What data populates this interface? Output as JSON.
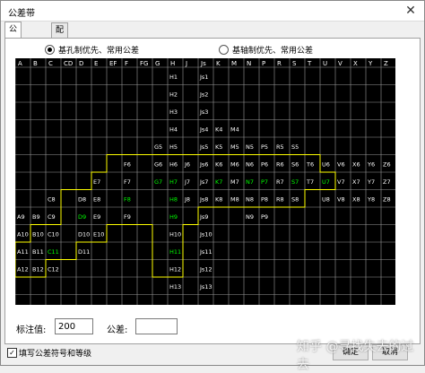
{
  "window": {
    "title": "公差带"
  },
  "tabs": [
    {
      "label": "公差查询",
      "active": true
    },
    {
      "label": "配合查询",
      "active": false
    }
  ],
  "options": {
    "hole_basis": {
      "label": "基孔制优先、常用公差",
      "checked": true
    },
    "shaft_basis": {
      "label": "基轴制优先、常用公差",
      "checked": false
    }
  },
  "columns": [
    "A",
    "B",
    "C",
    "CD",
    "D",
    "E",
    "EF",
    "F",
    "FG",
    "G",
    "H",
    "J",
    "Js",
    "K",
    "M",
    "N",
    "P",
    "R",
    "S",
    "T",
    "U",
    "V",
    "X",
    "Y",
    "Z"
  ],
  "cells": [
    {
      "t": "H1",
      "c": 10,
      "r": 1,
      "col": "w"
    },
    {
      "t": "Js1",
      "c": 12,
      "r": 1,
      "col": "w"
    },
    {
      "t": "H2",
      "c": 10,
      "r": 2,
      "col": "w"
    },
    {
      "t": "Js2",
      "c": 12,
      "r": 2,
      "col": "w"
    },
    {
      "t": "H3",
      "c": 10,
      "r": 3,
      "col": "w"
    },
    {
      "t": "Js3",
      "c": 12,
      "r": 3,
      "col": "w"
    },
    {
      "t": "H4",
      "c": 10,
      "r": 4,
      "col": "w"
    },
    {
      "t": "Js4",
      "c": 12,
      "r": 4,
      "col": "w"
    },
    {
      "t": "K4",
      "c": 13,
      "r": 4,
      "col": "w"
    },
    {
      "t": "M4",
      "c": 14,
      "r": 4,
      "col": "w"
    },
    {
      "t": "G5",
      "c": 9,
      "r": 5,
      "col": "w"
    },
    {
      "t": "H5",
      "c": 10,
      "r": 5,
      "col": "w"
    },
    {
      "t": "Js5",
      "c": 12,
      "r": 5,
      "col": "w"
    },
    {
      "t": "K5",
      "c": 13,
      "r": 5,
      "col": "w"
    },
    {
      "t": "M5",
      "c": 14,
      "r": 5,
      "col": "w"
    },
    {
      "t": "N5",
      "c": 15,
      "r": 5,
      "col": "w"
    },
    {
      "t": "P5",
      "c": 16,
      "r": 5,
      "col": "w"
    },
    {
      "t": "R5",
      "c": 17,
      "r": 5,
      "col": "w"
    },
    {
      "t": "S5",
      "c": 18,
      "r": 5,
      "col": "w"
    },
    {
      "t": "F6",
      "c": 7,
      "r": 6,
      "col": "w"
    },
    {
      "t": "G6",
      "c": 9,
      "r": 6,
      "col": "w"
    },
    {
      "t": "H6",
      "c": 10,
      "r": 6,
      "col": "w"
    },
    {
      "t": "J6",
      "c": 11,
      "r": 6,
      "col": "w"
    },
    {
      "t": "Js6",
      "c": 12,
      "r": 6,
      "col": "w"
    },
    {
      "t": "K6",
      "c": 13,
      "r": 6,
      "col": "w"
    },
    {
      "t": "M6",
      "c": 14,
      "r": 6,
      "col": "w"
    },
    {
      "t": "N6",
      "c": 15,
      "r": 6,
      "col": "w"
    },
    {
      "t": "P6",
      "c": 16,
      "r": 6,
      "col": "w"
    },
    {
      "t": "R6",
      "c": 17,
      "r": 6,
      "col": "w"
    },
    {
      "t": "S6",
      "c": 18,
      "r": 6,
      "col": "w"
    },
    {
      "t": "T6",
      "c": 19,
      "r": 6,
      "col": "w"
    },
    {
      "t": "U6",
      "c": 20,
      "r": 6,
      "col": "w"
    },
    {
      "t": "V6",
      "c": 21,
      "r": 6,
      "col": "w"
    },
    {
      "t": "X6",
      "c": 22,
      "r": 6,
      "col": "w"
    },
    {
      "t": "Y6",
      "c": 23,
      "r": 6,
      "col": "w"
    },
    {
      "t": "Z6",
      "c": 24,
      "r": 6,
      "col": "w"
    },
    {
      "t": "E7",
      "c": 5,
      "r": 7,
      "col": "w"
    },
    {
      "t": "F7",
      "c": 7,
      "r": 7,
      "col": "w"
    },
    {
      "t": "G7",
      "c": 9,
      "r": 7,
      "col": "g"
    },
    {
      "t": "H7",
      "c": 10,
      "r": 7,
      "col": "g"
    },
    {
      "t": "J7",
      "c": 11,
      "r": 7,
      "col": "w"
    },
    {
      "t": "Js7",
      "c": 12,
      "r": 7,
      "col": "w"
    },
    {
      "t": "K7",
      "c": 13,
      "r": 7,
      "col": "g"
    },
    {
      "t": "M7",
      "c": 14,
      "r": 7,
      "col": "w"
    },
    {
      "t": "N7",
      "c": 15,
      "r": 7,
      "col": "g"
    },
    {
      "t": "P7",
      "c": 16,
      "r": 7,
      "col": "g"
    },
    {
      "t": "R7",
      "c": 17,
      "r": 7,
      "col": "w"
    },
    {
      "t": "S7",
      "c": 18,
      "r": 7,
      "col": "g"
    },
    {
      "t": "T7",
      "c": 19,
      "r": 7,
      "col": "w"
    },
    {
      "t": "U7",
      "c": 20,
      "r": 7,
      "col": "g"
    },
    {
      "t": "V7",
      "c": 21,
      "r": 7,
      "col": "w"
    },
    {
      "t": "X7",
      "c": 22,
      "r": 7,
      "col": "w"
    },
    {
      "t": "Y7",
      "c": 23,
      "r": 7,
      "col": "w"
    },
    {
      "t": "Z7",
      "c": 24,
      "r": 7,
      "col": "w"
    },
    {
      "t": "C8",
      "c": 2,
      "r": 8,
      "col": "w"
    },
    {
      "t": "D8",
      "c": 4,
      "r": 8,
      "col": "w"
    },
    {
      "t": "E8",
      "c": 5,
      "r": 8,
      "col": "w"
    },
    {
      "t": "F8",
      "c": 7,
      "r": 8,
      "col": "g"
    },
    {
      "t": "H8",
      "c": 10,
      "r": 8,
      "col": "g"
    },
    {
      "t": "J8",
      "c": 11,
      "r": 8,
      "col": "w"
    },
    {
      "t": "Js8",
      "c": 12,
      "r": 8,
      "col": "w"
    },
    {
      "t": "K8",
      "c": 13,
      "r": 8,
      "col": "w"
    },
    {
      "t": "M8",
      "c": 14,
      "r": 8,
      "col": "w"
    },
    {
      "t": "N8",
      "c": 15,
      "r": 8,
      "col": "w"
    },
    {
      "t": "P8",
      "c": 16,
      "r": 8,
      "col": "w"
    },
    {
      "t": "R8",
      "c": 17,
      "r": 8,
      "col": "w"
    },
    {
      "t": "S8",
      "c": 18,
      "r": 8,
      "col": "w"
    },
    {
      "t": "U8",
      "c": 20,
      "r": 8,
      "col": "w"
    },
    {
      "t": "V8",
      "c": 21,
      "r": 8,
      "col": "w"
    },
    {
      "t": "X8",
      "c": 22,
      "r": 8,
      "col": "w"
    },
    {
      "t": "Y8",
      "c": 23,
      "r": 8,
      "col": "w"
    },
    {
      "t": "Z8",
      "c": 24,
      "r": 8,
      "col": "w"
    },
    {
      "t": "A9",
      "c": 0,
      "r": 9,
      "col": "w"
    },
    {
      "t": "B9",
      "c": 1,
      "r": 9,
      "col": "w"
    },
    {
      "t": "C9",
      "c": 2,
      "r": 9,
      "col": "w"
    },
    {
      "t": "D9",
      "c": 4,
      "r": 9,
      "col": "g"
    },
    {
      "t": "E9",
      "c": 5,
      "r": 9,
      "col": "w"
    },
    {
      "t": "F9",
      "c": 7,
      "r": 9,
      "col": "w"
    },
    {
      "t": "H9",
      "c": 10,
      "r": 9,
      "col": "g"
    },
    {
      "t": "Js9",
      "c": 12,
      "r": 9,
      "col": "w"
    },
    {
      "t": "N9",
      "c": 15,
      "r": 9,
      "col": "w"
    },
    {
      "t": "P9",
      "c": 16,
      "r": 9,
      "col": "w"
    },
    {
      "t": "A10",
      "c": 0,
      "r": 10,
      "col": "w"
    },
    {
      "t": "B10",
      "c": 1,
      "r": 10,
      "col": "w"
    },
    {
      "t": "C10",
      "c": 2,
      "r": 10,
      "col": "w"
    },
    {
      "t": "D10",
      "c": 4,
      "r": 10,
      "col": "w"
    },
    {
      "t": "E10",
      "c": 5,
      "r": 10,
      "col": "w"
    },
    {
      "t": "H10",
      "c": 10,
      "r": 10,
      "col": "w"
    },
    {
      "t": "Js10",
      "c": 12,
      "r": 10,
      "col": "w"
    },
    {
      "t": "A11",
      "c": 0,
      "r": 11,
      "col": "w"
    },
    {
      "t": "B11",
      "c": 1,
      "r": 11,
      "col": "w"
    },
    {
      "t": "C11",
      "c": 2,
      "r": 11,
      "col": "g"
    },
    {
      "t": "D11",
      "c": 4,
      "r": 11,
      "col": "w"
    },
    {
      "t": "H11",
      "c": 10,
      "r": 11,
      "col": "g"
    },
    {
      "t": "Js11",
      "c": 12,
      "r": 11,
      "col": "w"
    },
    {
      "t": "A12",
      "c": 0,
      "r": 12,
      "col": "w"
    },
    {
      "t": "B12",
      "c": 1,
      "r": 12,
      "col": "w"
    },
    {
      "t": "C12",
      "c": 2,
      "r": 12,
      "col": "w"
    },
    {
      "t": "H12",
      "c": 10,
      "r": 12,
      "col": "w"
    },
    {
      "t": "Js12",
      "c": 12,
      "r": 12,
      "col": "w"
    },
    {
      "t": "H13",
      "c": 10,
      "r": 13,
      "col": "w"
    },
    {
      "t": "Js13",
      "c": 12,
      "r": 13,
      "col": "w"
    }
  ],
  "fields": {
    "nominal_label": "标注值:",
    "nominal_value": "200",
    "tolerance_label": "公差:",
    "tolerance_value": ""
  },
  "footer": {
    "checkbox_label": "填写公差符号和等级",
    "checkbox_checked": true,
    "ok_label": "确定",
    "cancel_label": "取消"
  },
  "watermark": "知乎 @寻找失去的过去",
  "colors": {
    "grid_bg": "#000000",
    "grid_line": "#9a9a9a",
    "cell_text": "#ffffff",
    "preferred_text": "#00ff00",
    "highlight_border": "#ffff00"
  }
}
